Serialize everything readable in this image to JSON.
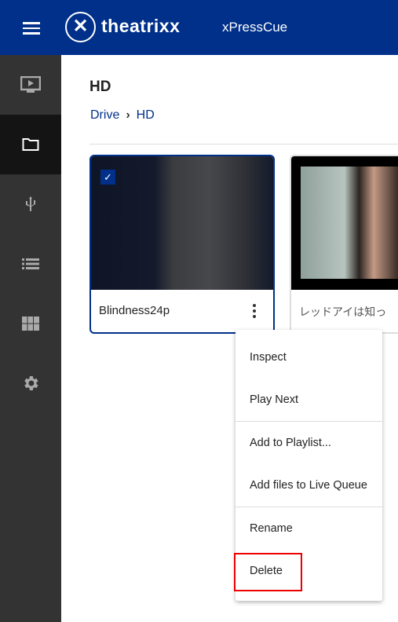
{
  "header": {
    "logo_mark": "X",
    "logo_text": "theatrixx",
    "app_name": "xPressCue",
    "brand_color": "#00308a"
  },
  "sidebar": {
    "items": [
      {
        "icon": "monitor-play-icon"
      },
      {
        "icon": "folder-icon",
        "active": true
      },
      {
        "icon": "usb-icon"
      },
      {
        "icon": "list-icon"
      },
      {
        "icon": "grid-icon"
      },
      {
        "icon": "gear-icon"
      }
    ]
  },
  "main": {
    "title": "HD",
    "breadcrumb": [
      "Drive",
      "HD"
    ],
    "cards": [
      {
        "name": "Blindness24p",
        "selected": true
      },
      {
        "name": "レッドアイは知っ"
      }
    ]
  },
  "context_menu": {
    "items": [
      "Inspect",
      "Play Next",
      "Add to Playlist...",
      "Add files to Live Queue",
      "Rename",
      "Delete"
    ],
    "highlighted": "Delete",
    "highlight_color": "#ee0000"
  }
}
